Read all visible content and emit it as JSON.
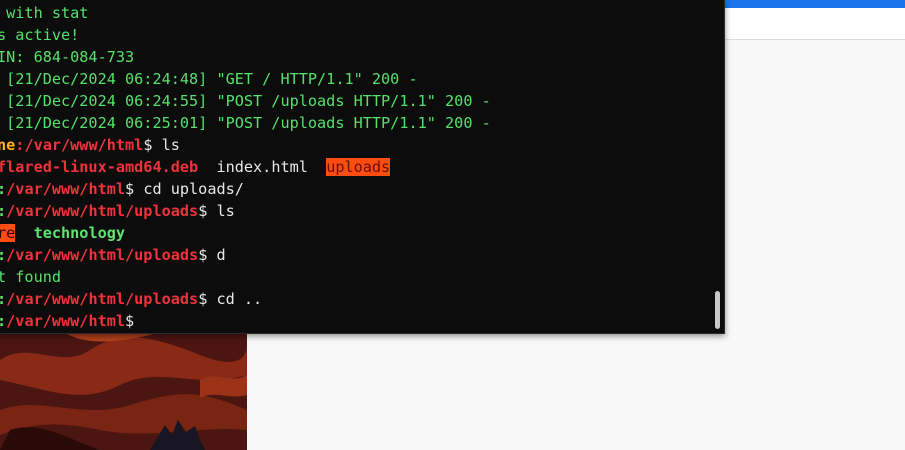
{
  "terminal": {
    "lines": [
      {
        "segments": [
          {
            "text": " with stat",
            "style": "green"
          }
        ]
      },
      {
        "segments": [
          {
            "text": "s active!",
            "style": "green"
          }
        ]
      },
      {
        "segments": [
          {
            "text": "IN: 684-084-733",
            "style": "green"
          }
        ]
      },
      {
        "segments": [
          {
            "text": " [21/Dec/2024 06:24:48] \"GET / HTTP/1.1\" 200 -",
            "style": "green"
          }
        ]
      },
      {
        "segments": [
          {
            "text": " [21/Dec/2024 06:24:55] \"POST /uploads HTTP/1.1\" 200 -",
            "style": "green"
          }
        ]
      },
      {
        "segments": [
          {
            "text": " [21/Dec/2024 06:25:01] \"POST /uploads HTTP/1.1\" 200 -",
            "style": "green"
          }
        ]
      },
      {
        "segments": [
          {
            "text": "ne",
            "style": "yellow-bold"
          },
          {
            "text": ":/var/www/html",
            "style": "red-bold"
          },
          {
            "text": "$ ls",
            "style": "white"
          }
        ]
      },
      {
        "segments": [
          {
            "text": "flared-linux-amd64.deb",
            "style": "red-bold-plain"
          },
          {
            "text": "  index.html  ",
            "style": "white"
          },
          {
            "text": "uploads",
            "style": "hl"
          }
        ]
      },
      {
        "segments": [
          {
            "text": ":/var/www/html",
            "style": "green-bold"
          },
          {
            "text": "$ cd uploads/",
            "style": "white"
          }
        ]
      },
      {
        "segments": [
          {
            "text": ":/var/www/html/uploads",
            "style": "green-bold"
          },
          {
            "text": "$ ls",
            "style": "white"
          }
        ]
      },
      {
        "segments": [
          {
            "text": "re",
            "style": "hl-dark"
          },
          {
            "text": "  ",
            "style": "white"
          },
          {
            "text": "technology",
            "style": "green-bold"
          }
        ]
      },
      {
        "segments": [
          {
            "text": ":/var/www/html/uploads",
            "style": "green-bold-red"
          },
          {
            "text": "$ d",
            "style": "white"
          }
        ]
      },
      {
        "segments": [
          {
            "text": "t found",
            "style": "green"
          }
        ]
      },
      {
        "segments": [
          {
            "text": ":/var/www/html/uploads",
            "style": "green-bold-red"
          },
          {
            "text": "$ cd ..",
            "style": "white"
          }
        ]
      },
      {
        "segments": [
          {
            "text": ":/var/www/html",
            "style": "green-bold-red"
          },
          {
            "text": "$",
            "style": "white"
          }
        ]
      }
    ]
  },
  "colors": {
    "terminal_bg": "#0c0c0c",
    "green": "#55e26a",
    "red": "#f0323a",
    "highlight": "#ff4d12",
    "browser_accent": "#1a73e8"
  }
}
